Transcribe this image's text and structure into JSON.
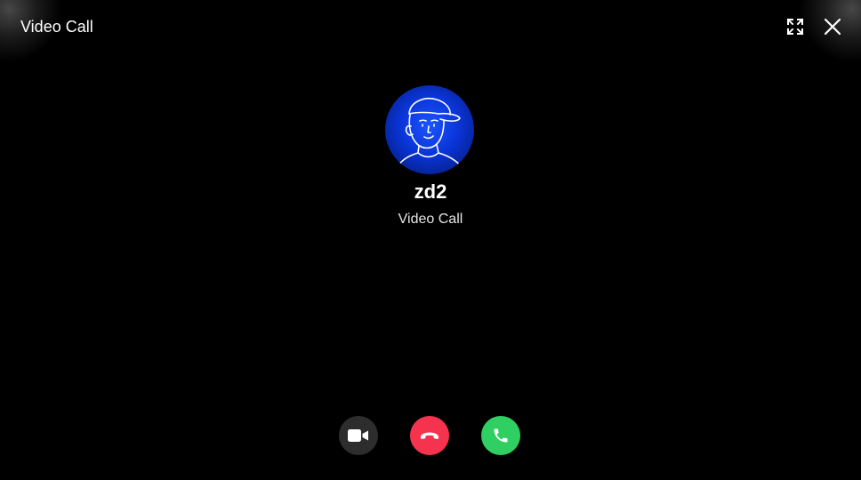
{
  "window": {
    "title": "Video Call"
  },
  "header": {
    "fullscreen_icon": "fullscreen-icon",
    "close_icon": "close-icon"
  },
  "caller": {
    "name": "zd2",
    "call_type": "Video Call",
    "avatar_bg": "#0a34d6"
  },
  "actions": {
    "camera_icon": "video-camera-icon",
    "decline_icon": "hang-up-icon",
    "accept_icon": "phone-icon",
    "camera_color": "#2d2d2d",
    "decline_color": "#f5334f",
    "accept_color": "#2fcf62"
  }
}
